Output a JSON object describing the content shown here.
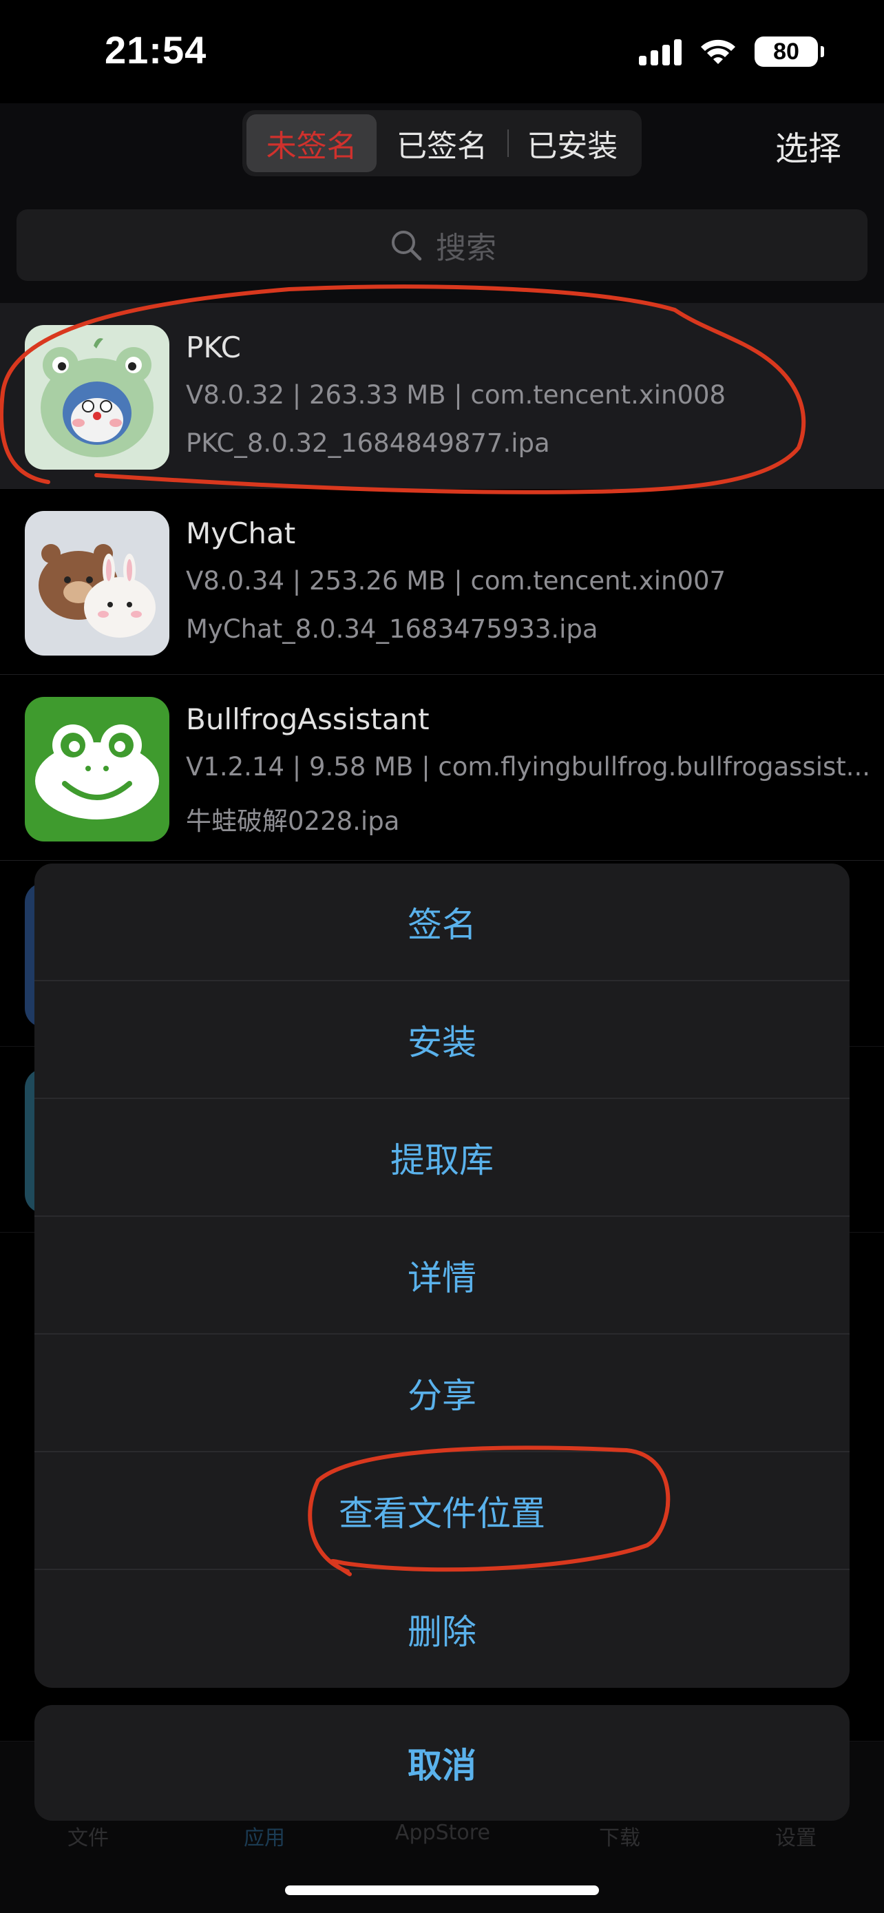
{
  "status_bar": {
    "time": "21:54",
    "battery": "80"
  },
  "nav": {
    "segments": [
      {
        "label": "未签名",
        "selected": true
      },
      {
        "label": "已签名",
        "selected": false
      },
      {
        "label": "已安装",
        "selected": false
      }
    ],
    "select_label": "选择"
  },
  "search": {
    "placeholder": "搜索"
  },
  "apps": [
    {
      "name": "PKC",
      "meta": "V8.0.32 | 263.33 MB | com.tencent.xin008",
      "file": "PKC_8.0.32_1684849877.ipa"
    },
    {
      "name": "MyChat",
      "meta": "V8.0.34 | 253.26 MB | com.tencent.xin007",
      "file": "MyChat_8.0.34_1683475933.ipa"
    },
    {
      "name": "BullfrogAssistant",
      "meta": "V1.2.14 | 9.58 MB | com.flyingbullfrog.bullfrogassist...",
      "file": "牛蛙破解0228.ipa"
    }
  ],
  "action_sheet": {
    "items": [
      "签名",
      "安装",
      "提取库",
      "详情",
      "分享",
      "查看文件位置",
      "删除"
    ],
    "cancel": "取消"
  },
  "tabs": [
    "文件",
    "应用",
    "AppStore",
    "下载",
    "设置"
  ],
  "colors": {
    "accent": "#5ab2ec",
    "annotation": "#d9381e",
    "selected_segment_text": "#d0312d"
  }
}
